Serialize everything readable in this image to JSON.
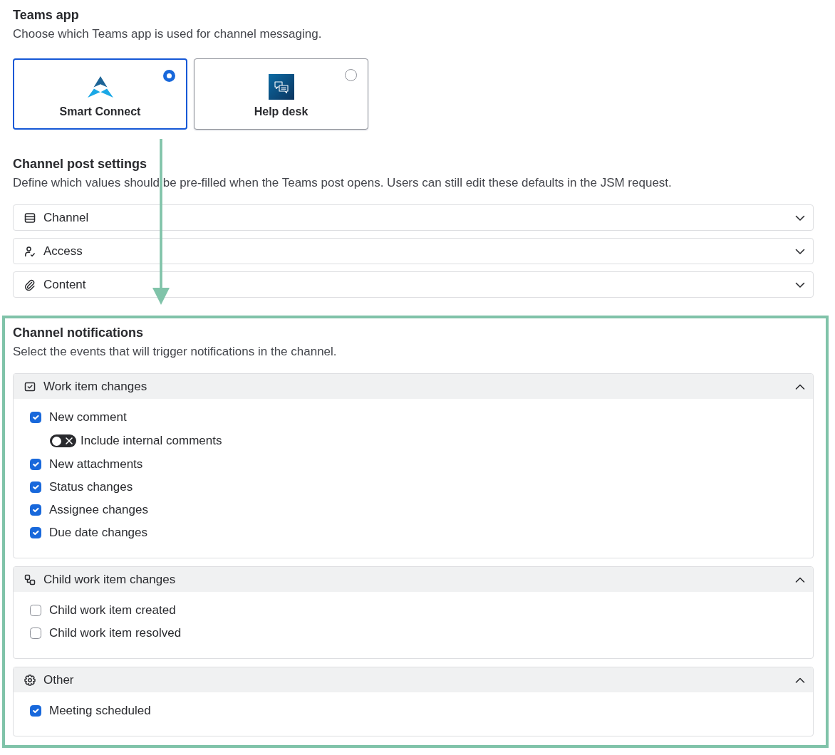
{
  "teams_app": {
    "title": "Teams app",
    "description": "Choose which Teams app is used for channel messaging.",
    "options": [
      {
        "label": "Smart Connect",
        "selected": true
      },
      {
        "label": "Help desk",
        "selected": false
      }
    ]
  },
  "channel_post_settings": {
    "title": "Channel post settings",
    "description": "Define which values should be pre-filled when the Teams post opens. Users can still edit these defaults in the JSM request.",
    "items": [
      {
        "label": "Channel",
        "expanded": false
      },
      {
        "label": "Access",
        "expanded": false
      },
      {
        "label": "Content",
        "expanded": false
      }
    ]
  },
  "channel_notifications": {
    "title": "Channel notifications",
    "description": "Select the events that will trigger notifications in the channel.",
    "highlighted": true,
    "groups": [
      {
        "label": "Work item changes",
        "expanded": true,
        "items": [
          {
            "kind": "checkbox",
            "label": "New comment",
            "checked": true,
            "children": [
              {
                "kind": "toggle",
                "label": "Include internal comments",
                "on": false
              }
            ]
          },
          {
            "kind": "checkbox",
            "label": "New attachments",
            "checked": true
          },
          {
            "kind": "checkbox",
            "label": "Status changes",
            "checked": true
          },
          {
            "kind": "checkbox",
            "label": "Assignee changes",
            "checked": true
          },
          {
            "kind": "checkbox",
            "label": "Due date changes",
            "checked": true
          }
        ]
      },
      {
        "label": "Child work item changes",
        "expanded": true,
        "items": [
          {
            "kind": "checkbox",
            "label": "Child work item created",
            "checked": false
          },
          {
            "kind": "checkbox",
            "label": "Child work item resolved",
            "checked": false
          }
        ]
      },
      {
        "label": "Other",
        "expanded": true,
        "items": [
          {
            "kind": "checkbox",
            "label": "Meeting scheduled",
            "checked": true
          }
        ]
      }
    ]
  }
}
